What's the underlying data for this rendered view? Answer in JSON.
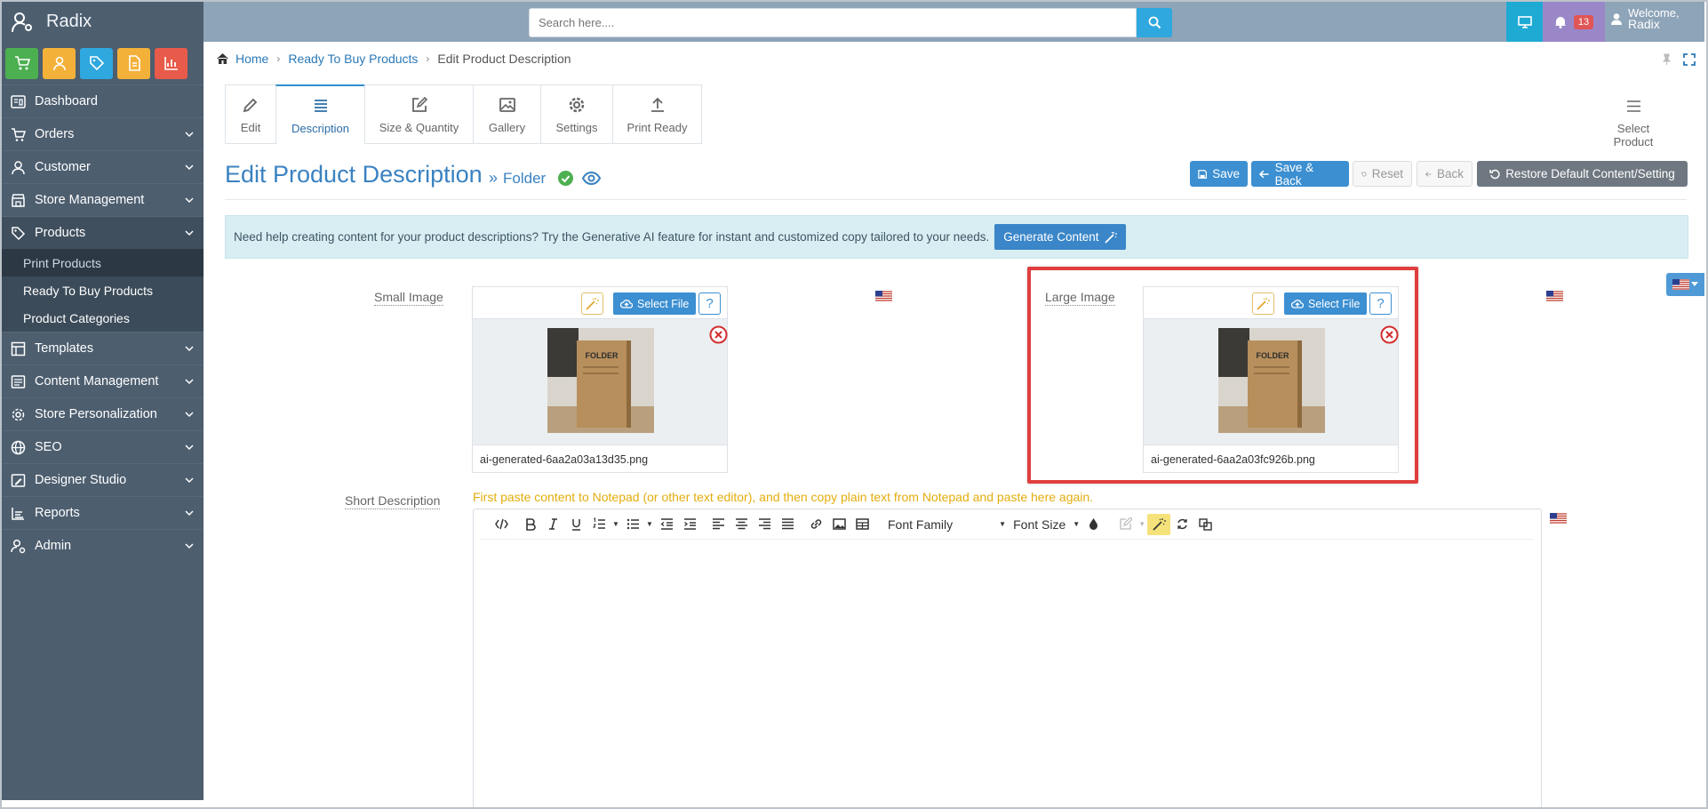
{
  "app": {
    "name": "Radix"
  },
  "colors": {
    "sidebar": "#4d5e6f",
    "topbar": "#8ea4b8",
    "accent": "#3c8fd1",
    "highlight": "#e03e3e",
    "note": "#e3ad0c"
  },
  "quick_buttons": [
    {
      "icon": "cart-icon",
      "color": "#4caf50"
    },
    {
      "icon": "user-icon",
      "color": "#f4b13a"
    },
    {
      "icon": "tag-icon",
      "color": "#2ea8de"
    },
    {
      "icon": "document-icon",
      "color": "#f4b13a"
    },
    {
      "icon": "chart-icon",
      "color": "#e85b4a"
    }
  ],
  "sidebar": {
    "items": [
      {
        "label": "Dashboard",
        "icon": "dashboard-icon"
      },
      {
        "label": "Orders",
        "icon": "cart-icon"
      },
      {
        "label": "Customer",
        "icon": "user-icon"
      },
      {
        "label": "Store Management",
        "icon": "store-icon"
      },
      {
        "label": "Products",
        "icon": "tag-icon"
      },
      {
        "label": "Templates",
        "icon": "template-icon"
      },
      {
        "label": "Content Management",
        "icon": "content-icon"
      },
      {
        "label": "Store Personalization",
        "icon": "gear-icon"
      },
      {
        "label": "SEO",
        "icon": "globe-icon"
      },
      {
        "label": "Designer Studio",
        "icon": "designer-icon"
      },
      {
        "label": "Reports",
        "icon": "reports-icon"
      },
      {
        "label": "Admin",
        "icon": "admin-icon"
      }
    ],
    "products_sub": [
      "Print Products",
      "Ready To Buy Products",
      "Product Categories"
    ]
  },
  "topbar": {
    "search_placeholder": "Search here....",
    "notification_count": "13",
    "welcome": "Welcome,",
    "user": "Radix"
  },
  "breadcrumb": {
    "home": "Home",
    "parent": "Ready To Buy Products",
    "current": "Edit Product Description"
  },
  "tabs": [
    {
      "label": "Edit",
      "icon": "pencil-icon"
    },
    {
      "label": "Description",
      "icon": "list-icon"
    },
    {
      "label": "Size & Quantity",
      "icon": "edit-icon"
    },
    {
      "label": "Gallery",
      "icon": "image-icon"
    },
    {
      "label": "Settings",
      "icon": "gear-icon"
    },
    {
      "label": "Print Ready",
      "icon": "upload-icon"
    }
  ],
  "select_product": "Select Product",
  "page": {
    "title": "Edit Product Description",
    "product": "Folder"
  },
  "actions": {
    "save": "Save",
    "save_back": "Save & Back",
    "reset": "Reset",
    "back": "Back",
    "restore": "Restore Default Content/Setting"
  },
  "ai": {
    "text": "Need help creating content for your product descriptions? Try the Generative AI feature for instant and customized copy tailored to your needs.",
    "button": "Generate Content"
  },
  "small_image": {
    "label": "Small Image",
    "select": "Select File",
    "help": "?",
    "file": "ai-generated-6aa2a03a13d35.png",
    "thumb_text": "FOLDER"
  },
  "large_image": {
    "label": "Large Image",
    "select": "Select File",
    "help": "?",
    "file": "ai-generated-6aa2a03fc926b.png",
    "thumb_text": "FOLDER"
  },
  "short_description": {
    "label": "Short Description",
    "note": "First paste content to Notepad (or other text editor), and then copy plain text from Notepad and paste here again.",
    "font_family": "Font Family",
    "font_size": "Font Size"
  }
}
